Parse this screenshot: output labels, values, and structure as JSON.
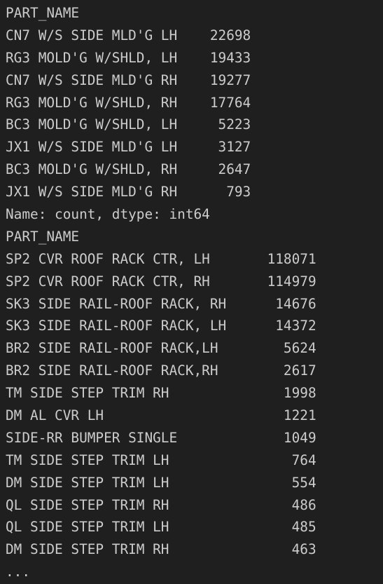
{
  "output": {
    "lines": [
      "PART_NAME",
      "CN7 W/S SIDE MLD'G LH    22698",
      "RG3 MOLD'G W/SHLD, LH    19433",
      "CN7 W/S SIDE MLD'G RH    19277",
      "RG3 MOLD'G W/SHLD, RH    17764",
      "BC3 MOLD'G W/SHLD, LH     5223",
      "JX1 W/S SIDE MLD'G LH     3127",
      "BC3 MOLD'G W/SHLD, RH     2647",
      "JX1 W/S SIDE MLD'G RH      793",
      "Name: count, dtype: int64",
      "PART_NAME",
      "SP2 CVR ROOF RACK CTR, LH       118071",
      "SP2 CVR ROOF RACK CTR, RH       114979",
      "SK3 SIDE RAIL-ROOF RACK, RH      14676",
      "SK3 SIDE RAIL-ROOF RACK, LH      14372",
      "BR2 SIDE RAIL-ROOF RACK,LH        5624",
      "BR2 SIDE RAIL-ROOF RACK,RH        2617",
      "TM SIDE STEP TRIM RH              1998",
      "DM AL CVR LH                      1221",
      "SIDE-RR BUMPER SINGLE             1049",
      "TM SIDE STEP TRIM LH               764",
      "DM SIDE STEP TRIM LH               554",
      "QL SIDE STEP TRIM RH               486",
      "QL SIDE STEP TRIM LH               485",
      "DM SIDE STEP TRIM RH               463",
      "..."
    ]
  }
}
